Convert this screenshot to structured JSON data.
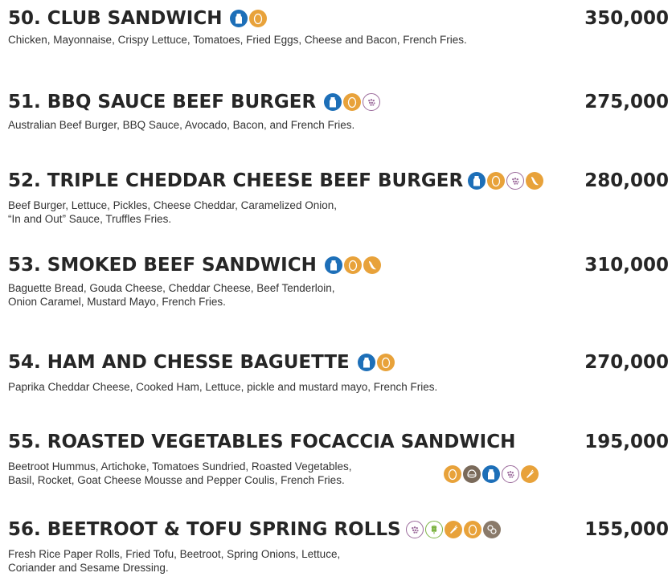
{
  "items": [
    {
      "title": "50. CLUB SANDWICH",
      "price": "350,000",
      "desc": [
        "Chicken, Mayonnaise, Crispy Lettuce, Tomatoes, Fried Eggs, Cheese and Bacon, French Fries."
      ],
      "icons": [
        "milk-icon",
        "egg-icon"
      ]
    },
    {
      "title": "51. BBQ SAUCE BEEF BURGER",
      "price": "275,000",
      "desc": [
        "Australian Beef Burger, BBQ Sauce, Avocado, Bacon, and French Fries."
      ],
      "icons": [
        "milk-icon",
        "egg-icon",
        "shellfish-icon"
      ]
    },
    {
      "title": "52. TRIPLE CHEDDAR CHEESE BEEF BURGER",
      "price": "280,000",
      "desc": [
        "Beef Burger, Lettuce, Pickles, Cheese Cheddar, Caramelized Onion,",
        "“In and Out” Sauce, Truffles Fries."
      ],
      "icons": [
        "milk-icon",
        "egg-icon",
        "shellfish-icon",
        "chili-icon"
      ]
    },
    {
      "title": "53. SMOKED BEEF SANDWICH",
      "price": "310,000",
      "desc": [
        "Baguette Bread, Gouda Cheese, Cheddar Cheese, Beef Tenderloin,",
        "Onion Caramel, Mustard Mayo, French Fries."
      ],
      "icons": [
        "milk-icon",
        "egg-icon",
        "chili-icon"
      ]
    },
    {
      "title": "54. HAM AND CHESSE BAGUETTE",
      "price": "270,000",
      "desc": [
        "Paprika Cheddar Cheese, Cooked Ham, Lettuce, pickle and mustard mayo, French Fries."
      ],
      "icons": [
        "milk-icon",
        "egg-icon"
      ]
    },
    {
      "title": "55. ROASTED VEGETABLES FOCACCIA SANDWICH",
      "price": "195,000",
      "desc": [
        "Beetroot Hummus, Artichoke, Tomatoes Sundried, Roasted Vegetables,",
        "Basil, Rocket, Goat Cheese Mousse and Pepper Coulis, French Fries."
      ],
      "icons": [
        "egg-icon",
        "nut-icon",
        "milk-icon",
        "shellfish-icon",
        "carrot-icon"
      ]
    },
    {
      "title": "56. BEETROOT & TOFU SPRING ROLLS",
      "price": "155,000",
      "desc": [
        "Fresh Rice Paper Rolls, Fried Tofu, Beetroot, Spring Onions, Lettuce,",
        "Coriander and Sesame Dressing."
      ],
      "icons": [
        "shellfish-icon",
        "gluten-icon",
        "carrot-icon",
        "egg-icon",
        "fish-icon"
      ]
    }
  ]
}
